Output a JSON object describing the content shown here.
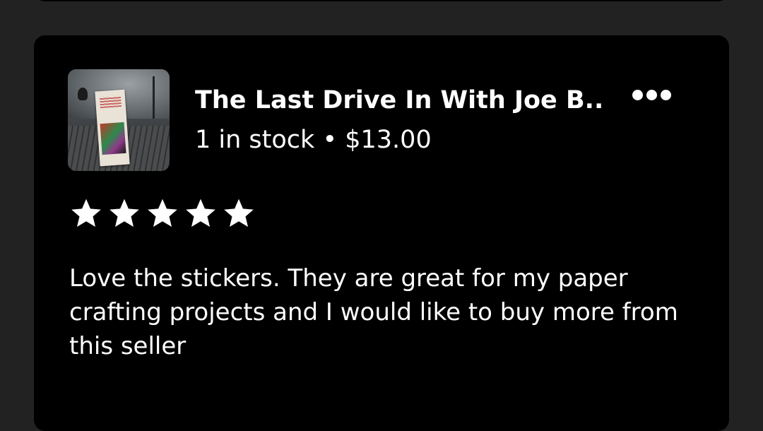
{
  "review_card": {
    "product": {
      "image_icon": "product-thumbnail",
      "title": "The Last Drive In With Joe B...",
      "stock": "1 in stock",
      "separator": "•",
      "price": "$13.00"
    },
    "more_icon": "more-horizontal-icon",
    "rating": {
      "value": 5,
      "max": 5,
      "icon": "star-icon"
    },
    "review_text": "Love the stickers. They are great for my paper crafting projects and I would like to buy more from this seller"
  },
  "colors": {
    "page_background": "#222222",
    "card_background": "#000000",
    "text": "#ffffff"
  }
}
